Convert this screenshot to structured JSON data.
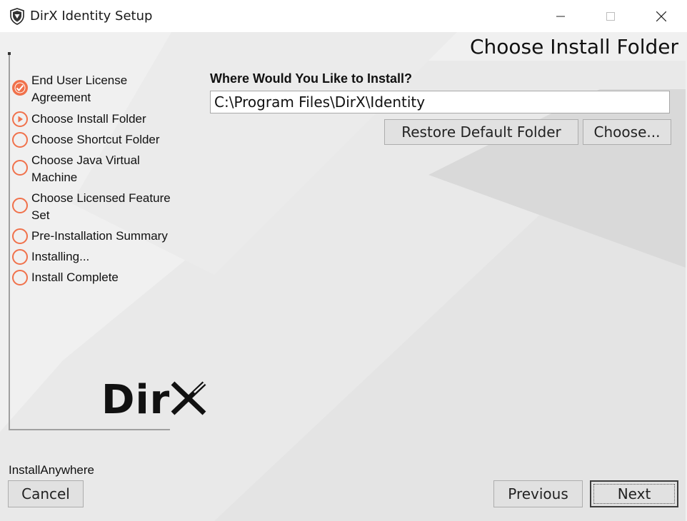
{
  "window": {
    "title": "DirX Identity Setup"
  },
  "page": {
    "title": "Choose Install Folder"
  },
  "steps": [
    {
      "label": "End User License Agreement",
      "status": "completed",
      "icon": "check-circle-icon"
    },
    {
      "label": "Choose Install Folder",
      "status": "current",
      "icon": "arrow-circle-icon"
    },
    {
      "label": "Choose Shortcut Folder",
      "status": "pending",
      "icon": "empty-circle-icon"
    },
    {
      "label": "Choose Java Virtual Machine",
      "status": "pending",
      "icon": "empty-circle-icon"
    },
    {
      "label": "Choose Licensed Feature Set",
      "status": "pending",
      "icon": "empty-circle-icon"
    },
    {
      "label": "Pre-Installation Summary",
      "status": "pending",
      "icon": "empty-circle-icon"
    },
    {
      "label": "Installing...",
      "status": "pending",
      "icon": "empty-circle-icon"
    },
    {
      "label": "Install Complete",
      "status": "pending",
      "icon": "empty-circle-icon"
    }
  ],
  "install": {
    "prompt": "Where Would You Like to Install?",
    "path": "C:\\Program Files\\DirX\\Identity",
    "restore_label": "Restore Default Folder",
    "choose_label": "Choose..."
  },
  "logo": {
    "text": "DirX"
  },
  "footer": {
    "brand": "InstallAnywhere",
    "cancel_label": "Cancel",
    "previous_label": "Previous",
    "next_label": "Next"
  },
  "colors": {
    "accent": "#f0714b",
    "background": "#f0f0f0"
  }
}
